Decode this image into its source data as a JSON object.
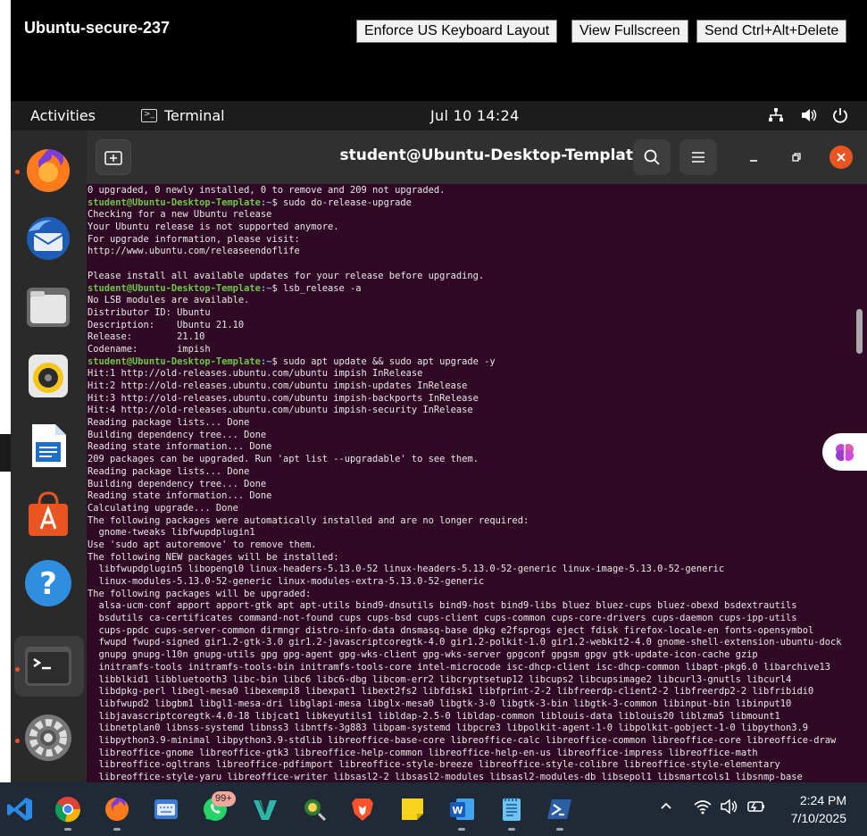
{
  "viewer": {
    "title": "Ubuntu-secure-237",
    "buttons": [
      "Enforce US Keyboard Layout",
      "View Fullscreen",
      "Send Ctrl+Alt+Delete"
    ]
  },
  "topbar": {
    "activities": "Activities",
    "app_name": "Terminal",
    "clock": "Jul 10  14:24"
  },
  "terminal": {
    "title": "student@Ubuntu-Desktop-Template: ~",
    "prompt_user": "student@Ubuntu-Desktop-Template",
    "prompt_path": ":~",
    "lines": [
      {
        "t": "o",
        "text": "0 upgraded, 0 newly installed, 0 to remove and 209 not upgraded."
      },
      {
        "t": "p",
        "text": "$ sudo do-release-upgrade"
      },
      {
        "t": "o",
        "text": "Checking for a new Ubuntu release"
      },
      {
        "t": "o",
        "text": "Your Ubuntu release is not supported anymore."
      },
      {
        "t": "o",
        "text": "For upgrade information, please visit:"
      },
      {
        "t": "o",
        "text": "http://www.ubuntu.com/releaseendoflife"
      },
      {
        "t": "o",
        "text": ""
      },
      {
        "t": "o",
        "text": "Please install all available updates for your release before upgrading."
      },
      {
        "t": "p",
        "text": "$ lsb_release -a"
      },
      {
        "t": "o",
        "text": "No LSB modules are available."
      },
      {
        "t": "o",
        "text": "Distributor ID:\tUbuntu"
      },
      {
        "t": "o",
        "text": "Description:\tUbuntu 21.10"
      },
      {
        "t": "o",
        "text": "Release:\t21.10"
      },
      {
        "t": "o",
        "text": "Codename:\timpish"
      },
      {
        "t": "p",
        "text": "$ sudo apt update && sudo apt upgrade -y"
      },
      {
        "t": "o",
        "text": "Hit:1 http://old-releases.ubuntu.com/ubuntu impish InRelease"
      },
      {
        "t": "o",
        "text": "Hit:2 http://old-releases.ubuntu.com/ubuntu impish-updates InRelease"
      },
      {
        "t": "o",
        "text": "Hit:3 http://old-releases.ubuntu.com/ubuntu impish-backports InRelease"
      },
      {
        "t": "o",
        "text": "Hit:4 http://old-releases.ubuntu.com/ubuntu impish-security InRelease"
      },
      {
        "t": "o",
        "text": "Reading package lists... Done"
      },
      {
        "t": "o",
        "text": "Building dependency tree... Done"
      },
      {
        "t": "o",
        "text": "Reading state information... Done"
      },
      {
        "t": "o",
        "text": "209 packages can be upgraded. Run 'apt list --upgradable' to see them."
      },
      {
        "t": "o",
        "text": "Reading package lists... Done"
      },
      {
        "t": "o",
        "text": "Building dependency tree... Done"
      },
      {
        "t": "o",
        "text": "Reading state information... Done"
      },
      {
        "t": "o",
        "text": "Calculating upgrade... Done"
      },
      {
        "t": "o",
        "text": "The following packages were automatically installed and are no longer required:"
      },
      {
        "t": "o",
        "text": "  gnome-tweaks libfwupdplugin1"
      },
      {
        "t": "o",
        "text": "Use 'sudo apt autoremove' to remove them."
      },
      {
        "t": "o",
        "text": "The following NEW packages will be installed:"
      },
      {
        "t": "o",
        "text": "  libfwupdplugin5 libopengl0 linux-headers-5.13.0-52 linux-headers-5.13.0-52-generic linux-image-5.13.0-52-generic"
      },
      {
        "t": "o",
        "text": "  linux-modules-5.13.0-52-generic linux-modules-extra-5.13.0-52-generic"
      },
      {
        "t": "o",
        "text": "The following packages will be upgraded:"
      },
      {
        "t": "o",
        "text": "  alsa-ucm-conf apport apport-gtk apt apt-utils bind9-dnsutils bind9-host bind9-libs bluez bluez-cups bluez-obexd bsdextrautils"
      },
      {
        "t": "o",
        "text": "  bsdutils ca-certificates command-not-found cups cups-bsd cups-client cups-common cups-core-drivers cups-daemon cups-ipp-utils"
      },
      {
        "t": "o",
        "text": "  cups-ppdc cups-server-common dirmngr distro-info-data dnsmasq-base dpkg e2fsprogs eject fdisk firefox-locale-en fonts-opensymbol"
      },
      {
        "t": "o",
        "text": "  fwupd fwupd-signed gir1.2-gtk-3.0 gir1.2-javascriptcoregtk-4.0 gir1.2-polkit-1.0 gir1.2-webkit2-4.0 gnome-shell-extension-ubuntu-dock"
      },
      {
        "t": "o",
        "text": "  gnupg gnupg-l10n gnupg-utils gpg gpg-agent gpg-wks-client gpg-wks-server gpgconf gpgsm gpgv gtk-update-icon-cache gzip"
      },
      {
        "t": "o",
        "text": "  initramfs-tools initramfs-tools-bin initramfs-tools-core intel-microcode isc-dhcp-client isc-dhcp-common libapt-pkg6.0 libarchive13"
      },
      {
        "t": "o",
        "text": "  libblkid1 libbluetooth3 libc-bin libc6 libc6-dbg libcom-err2 libcryptsetup12 libcups2 libcupsimage2 libcurl3-gnutls libcurl4"
      },
      {
        "t": "o",
        "text": "  libdpkg-perl libegl-mesa0 libexempi8 libexpat1 libext2fs2 libfdisk1 libfprint-2-2 libfreerdp-client2-2 libfreerdp2-2 libfribidi0"
      },
      {
        "t": "o",
        "text": "  libfwupd2 libgbm1 libgl1-mesa-dri libglapi-mesa libglx-mesa0 libgtk-3-0 libgtk-3-bin libgtk-3-common libinput-bin libinput10"
      },
      {
        "t": "o",
        "text": "  libjavascriptcoregtk-4.0-18 libjcat1 libkeyutils1 libldap-2.5-0 libldap-common liblouis-data liblouis20 liblzma5 libmount1"
      },
      {
        "t": "o",
        "text": "  libnetplan0 libnss-systemd libnss3 libntfs-3g883 libpam-systemd libpcre3 libpolkit-agent-1-0 libpolkit-gobject-1-0 libpython3.9"
      },
      {
        "t": "o",
        "text": "  libpython3.9-minimal libpython3.9-stdlib libreoffice-base-core libreoffice-calc libreoffice-common libreoffice-core libreoffice-draw"
      },
      {
        "t": "o",
        "text": "  libreoffice-gnome libreoffice-gtk3 libreoffice-help-common libreoffice-help-en-us libreoffice-impress libreoffice-math"
      },
      {
        "t": "o",
        "text": "  libreoffice-ogltrans libreoffice-pdfimport libreoffice-style-breeze libreoffice-style-colibre libreoffice-style-elementary"
      },
      {
        "t": "o",
        "text": "  libreoffice-style-yaru libreoffice-writer libsasl2-2 libsasl2-modules libsasl2-modules-db libsepol1 libsmartcols1 libsnmp-base"
      }
    ]
  },
  "taskbar": {
    "badge": "99+",
    "time": "2:24 PM",
    "date": "7/10/2025"
  },
  "colors": {
    "terminal_bg": "#300a24",
    "prompt_green": "#6dc64a",
    "path_blue": "#7aa6da",
    "accent_orange": "#e95420",
    "taskbar_bg": "#202a36"
  }
}
